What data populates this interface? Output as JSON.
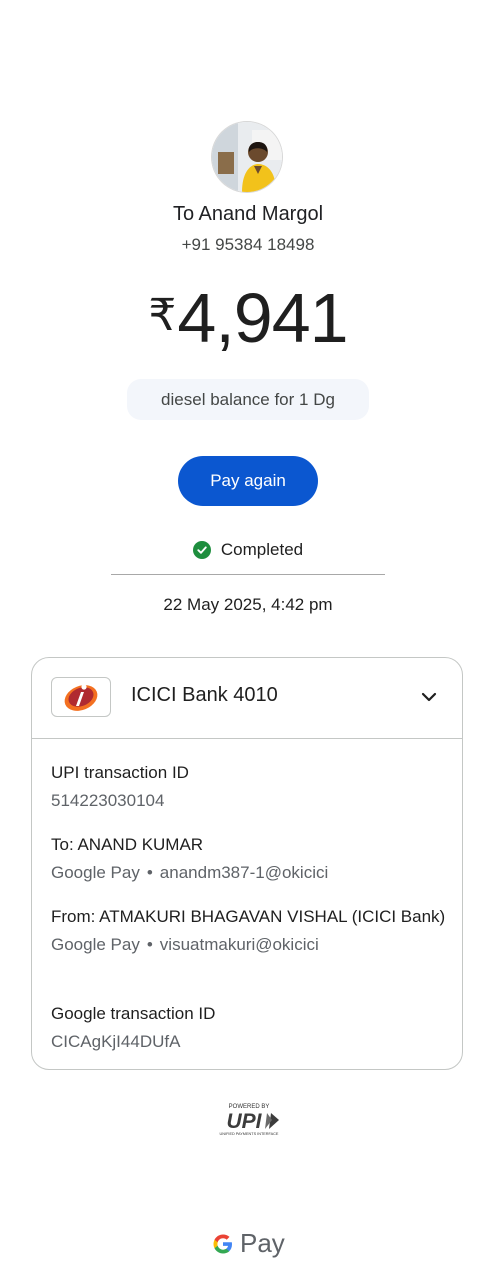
{
  "recipient": {
    "name": "To Anand Margol",
    "phone": "+91 95384 18498",
    "avatar": "profile-photo"
  },
  "payment": {
    "currency_symbol": "₹",
    "amount": "4,941",
    "note": "diesel balance for 1 Dg",
    "pay_again_label": "Pay again",
    "status": "Completed",
    "datetime": "22 May 2025, 4:42 pm"
  },
  "bank": {
    "name": "ICICI Bank 4010",
    "logo_icon": "icici-logo-icon",
    "expand_icon": "chevron-down-icon"
  },
  "details": {
    "upi_txn_label": "UPI transaction ID",
    "upi_txn_value": "514223030104",
    "to_label": "To: ANAND KUMAR",
    "to_app": "Google Pay",
    "to_upi": "anandm387-1@okicici",
    "from_label": "From: ATMAKURI BHAGAVAN VISHAL (ICICI Bank)",
    "from_app": "Google Pay",
    "from_upi": "visuatmakuri@okicici",
    "google_txn_label": "Google transaction ID",
    "google_txn_value": "CICAgKjI44DUfA",
    "separator": "•"
  },
  "footer": {
    "upi_powered": "POWERED BY",
    "upi_word": "UPI",
    "upi_sub": "UNIFIED PAYMENTS INTERFACE",
    "gpay_g": "G",
    "gpay_text": "Pay"
  },
  "colors": {
    "primary_button": "#0b57d0",
    "success": "#1e8e3e",
    "icici_orange": "#f37021",
    "icici_red": "#b02a30"
  }
}
